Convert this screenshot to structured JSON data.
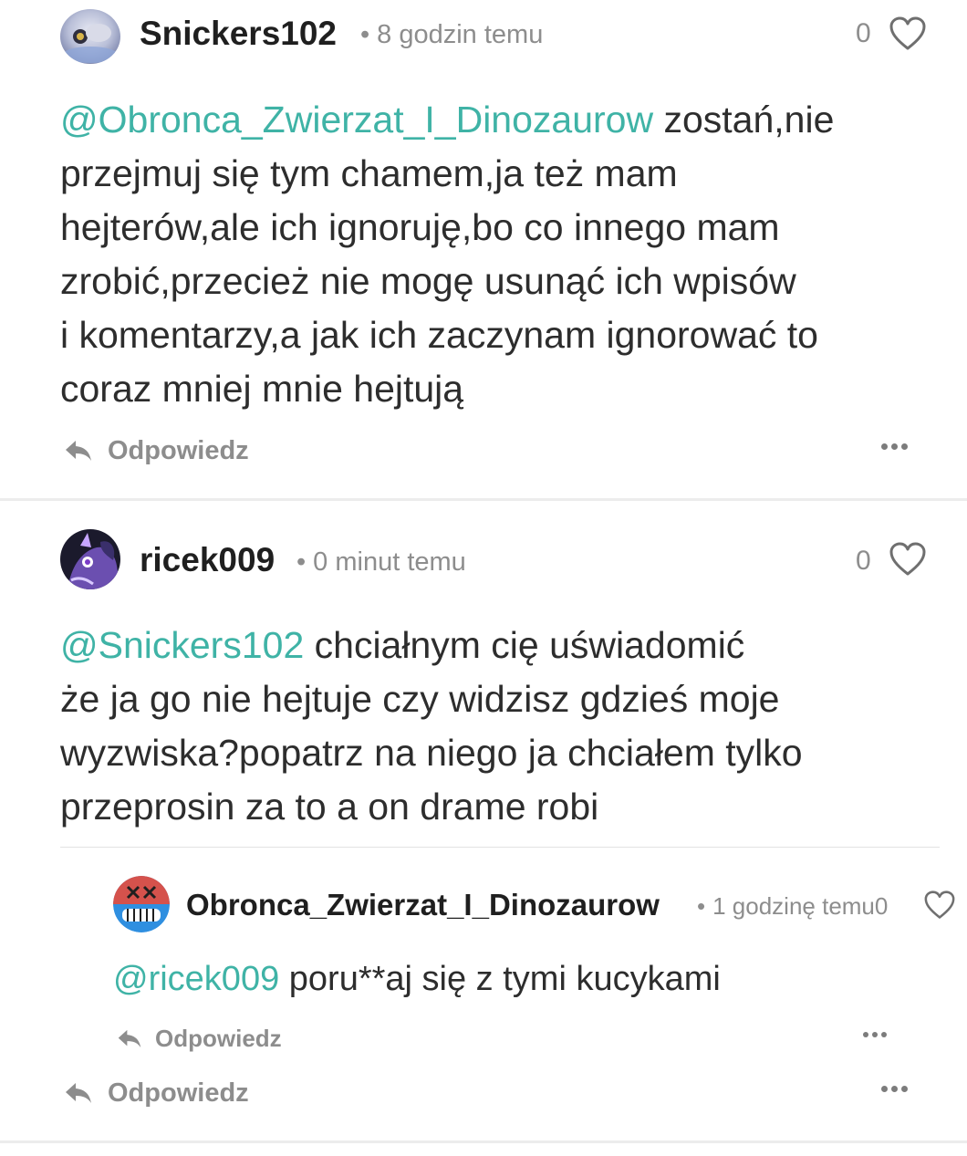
{
  "comments": [
    {
      "username": "Snickers102",
      "time": "8 godzin temu",
      "likes": "0",
      "mention": "@Obronca_Zwierzat_I_Dinozaurow",
      "lines": [
        " zostań,nie",
        "przejmuj się tym chamem,ja też mam",
        "hejterów,ale ich ignoruję,bo co innego mam",
        "zrobić,przecież nie mogę usunąć ich wpisów",
        "i komentarzy,a jak ich zaczynam ignorować to",
        "coraz mniej mnie hejtują"
      ],
      "reply_label": "Odpowiedz"
    },
    {
      "username": "ricek009",
      "time": "0 minut temu",
      "likes": "0",
      "mention": "@Snickers102",
      "lines": [
        " chciałnym cię uświadomić",
        "że ja go nie hejtuje czy widzisz gdzieś moje",
        "wyzwiska?popatrz na niego ja chciałem tylko",
        "przeprosin za to a on drame robi"
      ],
      "reply_label": "Odpowiedz",
      "nested": {
        "username": "Obronca_Zwierzat_I_Dinozaurow",
        "time": "1 godzinę temu",
        "likes": "0",
        "mention": "@ricek009",
        "text": " poru**aj się z tymi kucykami",
        "reply_label": "Odpowiedz"
      }
    }
  ],
  "meta_separator": "•",
  "colors": {
    "mention": "#3fb3a6",
    "text": "#2d2d2d",
    "muted": "#8d8d8d",
    "divider": "#ececec"
  },
  "icons": {
    "like": "heart-icon",
    "reply": "reply-arrow-icon",
    "more": "more-options-icon"
  }
}
